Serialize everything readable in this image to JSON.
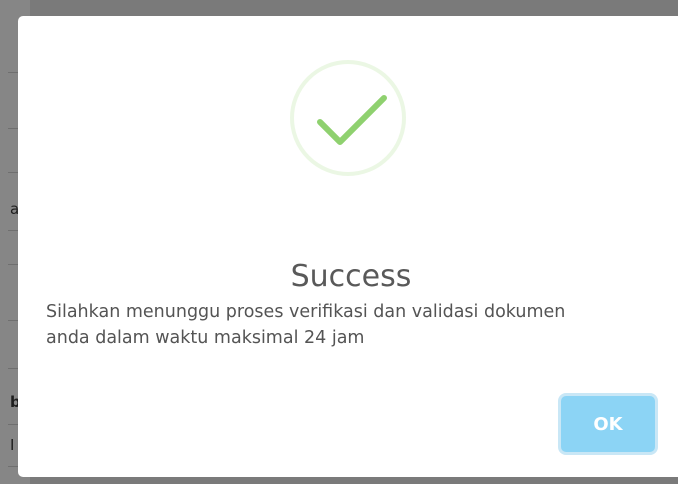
{
  "background": {
    "fragments": [
      "a",
      "b",
      "I"
    ]
  },
  "dialog": {
    "icon": "checkmark-icon",
    "title": "Success",
    "message_line1": "Silahkan menunggu proses verifikasi dan validasi dokumen",
    "message_line2": "anda dalam waktu maksimal 24 jam",
    "ok_label": "OK",
    "colors": {
      "success": "#a5dc86",
      "button": "#8cd4f5",
      "title": "#595959",
      "text": "#545454"
    }
  }
}
